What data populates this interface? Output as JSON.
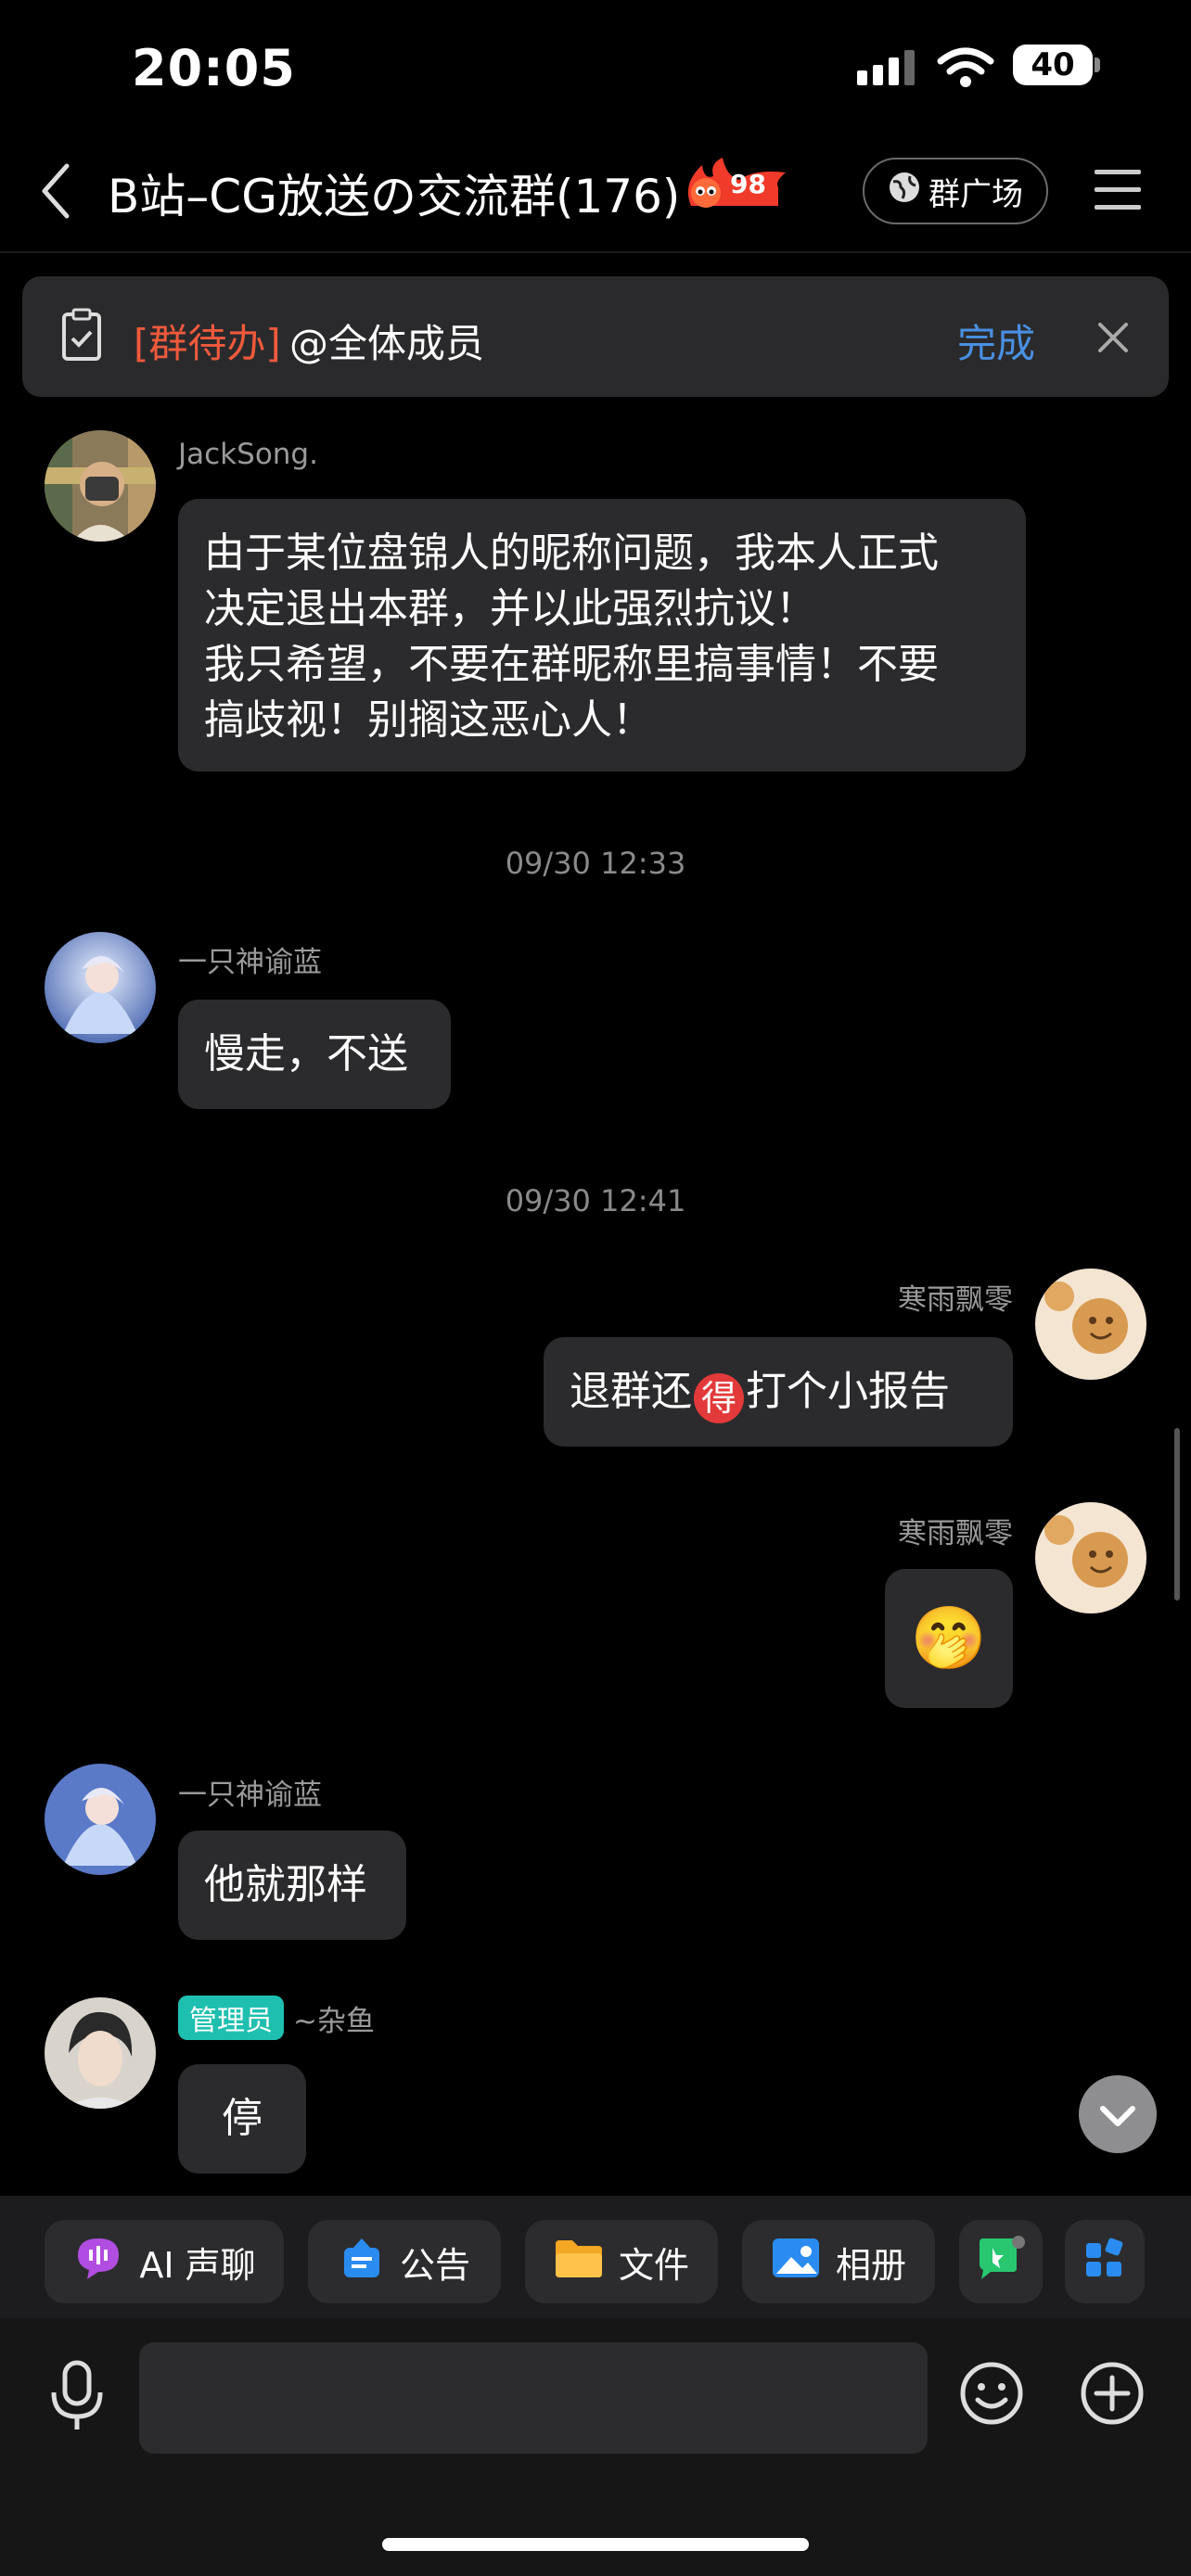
{
  "status_bar": {
    "time": "20:05",
    "battery": "40"
  },
  "header": {
    "title": "B站–CG放送の交流群(176)",
    "fire_count": "98",
    "plaza_label": "群广场"
  },
  "todo": {
    "tag": "[群待办]",
    "text": "@全体成员",
    "done_label": "完成"
  },
  "messages": {
    "m1": {
      "sender": "JackSong.",
      "lines": [
        "由于某位盘锦人的昵称问题，我本人正式",
        "决定退出本群，并以此强烈抗议！",
        "我只希望，不要在群昵称里搞事情！不要",
        "搞歧视！别搁这恶心人！"
      ]
    },
    "t1": "09/30 12:33",
    "m2": {
      "sender": "一只神谕蓝",
      "text": "慢走，不送"
    },
    "t2": "09/30 12:41",
    "m3": {
      "sender": "寒雨飘零",
      "text_before": "退群还",
      "emoji_char": "得",
      "text_after": "打个小报告"
    },
    "m4": {
      "sender": "寒雨飘零",
      "emoji": "🤭"
    },
    "m5": {
      "sender": "一只神谕蓝",
      "text": "他就那样"
    },
    "m6": {
      "badge": "管理员",
      "sender": "~杂鱼",
      "text": "停"
    }
  },
  "toolbar": {
    "ai_voice": "AI 声聊",
    "notice": "公告",
    "files": "文件",
    "album": "相册"
  },
  "input": {
    "value": ""
  },
  "colors": {
    "accent_blue": "#4a90e2",
    "todo_red": "#f05a3c",
    "admin_teal": "#1fbfb0",
    "bubble": "#2b2b2d"
  }
}
